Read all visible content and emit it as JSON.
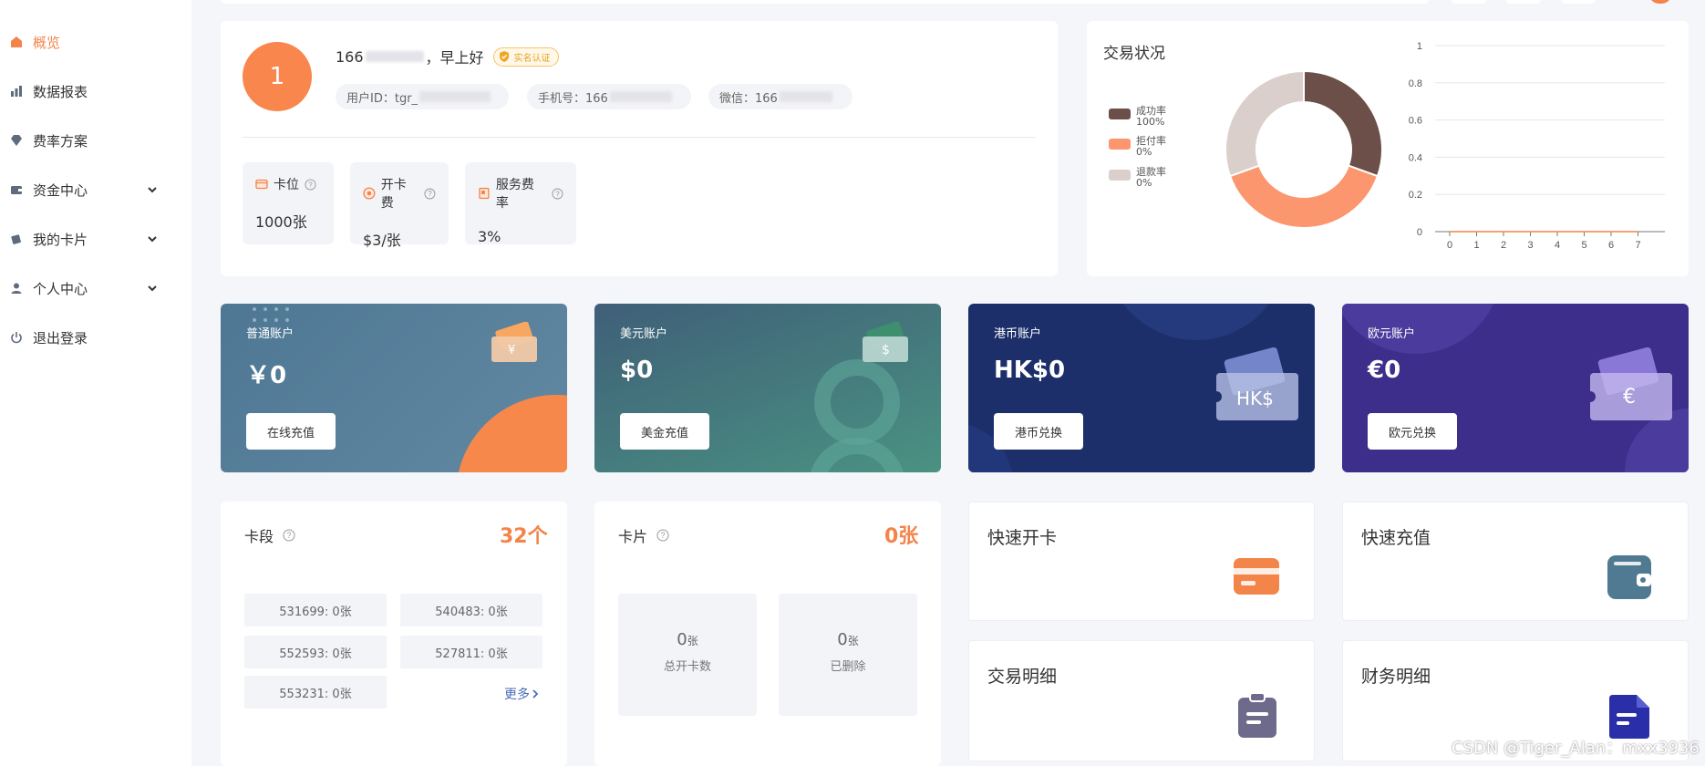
{
  "sidebar": {
    "items": [
      {
        "label": "概览",
        "icon": "home-icon",
        "active": true
      },
      {
        "label": "数据报表",
        "icon": "bar-chart-icon"
      },
      {
        "label": "费率方案",
        "icon": "diamond-icon"
      },
      {
        "label": "资金中心",
        "icon": "wallet-icon",
        "expandable": true
      },
      {
        "label": "我的卡片",
        "icon": "cards-icon",
        "expandable": true
      },
      {
        "label": "个人中心",
        "icon": "user-icon",
        "expandable": true
      },
      {
        "label": "退出登录",
        "icon": "power-icon"
      }
    ]
  },
  "profile": {
    "avatar_text": "1",
    "name_prefix": "166",
    "greeting": "，早上好",
    "verified_badge": "实名认证",
    "user_id_label": "用户ID：tgr_",
    "phone_label": "手机号：166",
    "wechat_label": "微信：166"
  },
  "stats": [
    {
      "label": "卡位",
      "value": "1000张"
    },
    {
      "label": "开卡费",
      "value": "$3/张"
    },
    {
      "label": "服务费率",
      "value": "3%"
    }
  ],
  "transaction": {
    "title": "交易状况",
    "legend": [
      {
        "name": "成功率",
        "value": "100%",
        "color": "#6b4f48"
      },
      {
        "name": "拒付率",
        "value": "0%",
        "color": "#fb966e"
      },
      {
        "name": "退款率",
        "value": "0%",
        "color": "#dacfcb"
      }
    ]
  },
  "chart_data": [
    {
      "type": "pie",
      "labels": [
        "成功率",
        "拒付率",
        "退款率"
      ],
      "values": [
        100,
        0,
        0
      ],
      "colors": [
        "#6b4f48",
        "#fb966e",
        "#dacfcb"
      ]
    },
    {
      "type": "line",
      "x": [
        0,
        1,
        2,
        3,
        4,
        5,
        6,
        7
      ],
      "y_ticks": [
        "0",
        "0.2",
        "0.4",
        "0.6",
        "0.8",
        "1"
      ],
      "x_ticks": [
        "0",
        "1",
        "2",
        "3",
        "4",
        "5",
        "6",
        "7"
      ],
      "ylim": [
        0,
        1
      ],
      "grid": true,
      "series_color": "#f3844a"
    }
  ],
  "accounts": [
    {
      "name": "普通账户",
      "balance": "￥0",
      "button": "在线充值",
      "icon_symbol": "¥"
    },
    {
      "name": "美元账户",
      "balance": "$0",
      "button": "美金充值",
      "icon_symbol": "$"
    },
    {
      "name": "港币账户",
      "balance": "HK$0",
      "button": "港币兑换",
      "icon_symbol": "HK$"
    },
    {
      "name": "欧元账户",
      "balance": "€0",
      "button": "欧元兑换",
      "icon_symbol": "€"
    }
  ],
  "segments": {
    "title": "卡段",
    "count": "32个",
    "items": [
      "531699: 0张",
      "540483: 0张",
      "552593: 0张",
      "527811: 0张",
      "553231: 0张"
    ],
    "more": "更多"
  },
  "cards": {
    "title": "卡片",
    "count": "0张",
    "boxes": [
      {
        "num": "0",
        "unit": "张",
        "caption": "总开卡数"
      },
      {
        "num": "0",
        "unit": "张",
        "caption": "已删除"
      }
    ]
  },
  "quick": [
    {
      "title": "快速开卡",
      "icon": "credit-card-icon",
      "color": "#f3844a"
    },
    {
      "title": "快速充值",
      "icon": "wallet-icon",
      "color": "#4f7a91"
    },
    {
      "title": "交易明细",
      "icon": "clipboard-icon",
      "color": "#6e6a8c"
    },
    {
      "title": "财务明细",
      "icon": "document-icon",
      "color": "#2a2ea8"
    }
  ],
  "watermark": "CSDN @Tiger_Alan：mxx3936"
}
